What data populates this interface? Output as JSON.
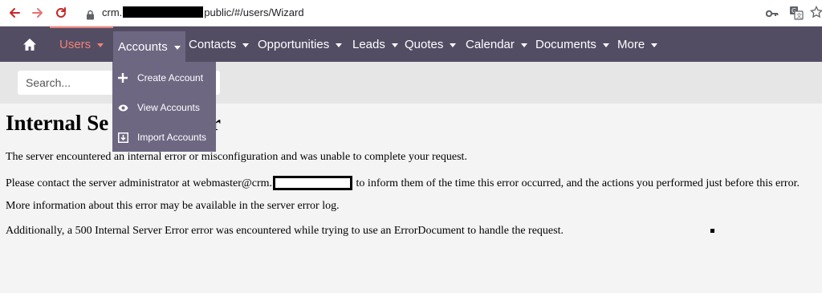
{
  "browser": {
    "url_prefix": "crm.",
    "url_suffix": "public/#/users/Wizard"
  },
  "nav": {
    "items": [
      {
        "label": "Users"
      },
      {
        "label": "Accounts"
      },
      {
        "label": "Contacts"
      },
      {
        "label": "Opportunities"
      },
      {
        "label": "Leads"
      },
      {
        "label": "Quotes"
      },
      {
        "label": "Calendar"
      },
      {
        "label": "Documents"
      },
      {
        "label": "More"
      }
    ]
  },
  "search": {
    "placeholder": "Search..."
  },
  "dropdown": {
    "items": [
      {
        "label": "Create Account",
        "icon": "plus-icon"
      },
      {
        "label": "View Accounts",
        "icon": "eye-icon"
      },
      {
        "label": "Import Accounts",
        "icon": "import-icon"
      }
    ]
  },
  "error": {
    "title_start": "Internal Se",
    "title_end": "r",
    "p1": "The server encountered an internal error or misconfiguration and was unable to complete your request.",
    "p2_before": "Please contact the server administrator at webmaster@crm.",
    "p2_after": "to inform them of the time this error occurred, and the actions you performed just before this error.",
    "p3": "More information about this error may be available in the server error log.",
    "p4": "Additionally, a 500 Internal Server Error error was encountered while trying to use an ErrorDocument to handle the request."
  },
  "colors": {
    "nav_bg": "#534d64",
    "dropdown_bg": "#6e6782",
    "users_accent": "#f08377"
  }
}
